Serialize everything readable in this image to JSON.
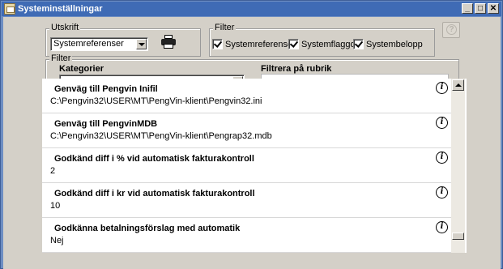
{
  "window": {
    "title": "Systeminställningar",
    "controls": {
      "minimize": "_",
      "maximize": "□",
      "close": "✕"
    }
  },
  "utskrift": {
    "legend": "Utskrift",
    "report_select": "Systemreferenser",
    "print_icon": "printer-icon"
  },
  "filter_top": {
    "legend": "Filter",
    "checkboxes": [
      {
        "label": "Systemreferenser",
        "checked": true
      },
      {
        "label": "Systemflaggor",
        "checked": true
      },
      {
        "label": "Systembelopp",
        "checked": true
      }
    ]
  },
  "help_button": {
    "label": "?"
  },
  "filter_bottom": {
    "legend": "Filter",
    "kategorier_label": "Kategorier",
    "kategorier_value": "",
    "rubrik_label": "Filtrera på rubrik",
    "rubrik_value": ""
  },
  "settings": [
    {
      "title": "Genväg till Pengvin Inifil",
      "value": "C:\\Pengvin32\\USER\\MT\\PengVin-klient\\Pengvin32.ini"
    },
    {
      "title": "Genväg till PengvinMDB",
      "value": "C:\\Pengvin32\\USER\\MT\\PengVin-klient\\Pengrap32.mdb"
    },
    {
      "title": "Godkänd diff i % vid automatisk fakturakontroll",
      "value": "2"
    },
    {
      "title": "Godkänd diff i kr vid automatisk fakturakontroll",
      "value": "10"
    },
    {
      "title": "Godkänna betalningsförslag med automatik",
      "value": "Nej"
    }
  ],
  "info_icon_glyph": "i",
  "colors": {
    "titlebar": "#3f6bb5",
    "frame": "#6d8ec2",
    "face": "#d4d0c8"
  }
}
